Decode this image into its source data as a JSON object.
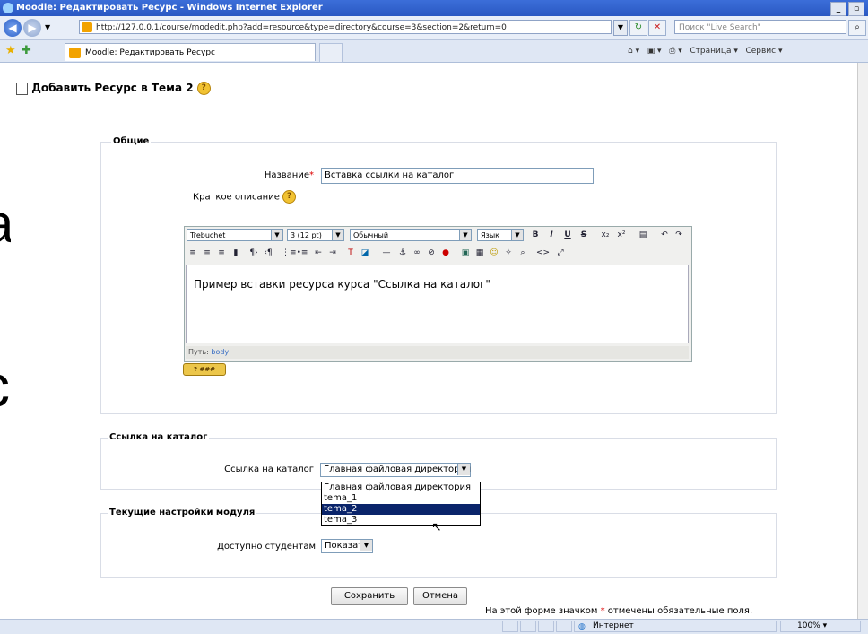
{
  "window": {
    "title": "Moodle: Редактировать Ресурс - Windows Internet Explorer",
    "url": "http://127.0.0.1/course/modedit.php?add=resource&type=directory&course=3&section=2&return=0",
    "search_placeholder": "Поиск \"Live Search\"",
    "tab_title": "Moodle: Редактировать Ресурс",
    "toolbar_page": "Страница",
    "toolbar_service": "Сервис"
  },
  "bleed": {
    "letter1": "a",
    "letter2": "c"
  },
  "page": {
    "heading": "Добавить Ресурс в Тема 2",
    "general_legend": "Общие",
    "name_label": "Название",
    "name_value": "Вставка ссылки на каталог",
    "summary_label": "Краткое описание",
    "editor": {
      "font": "Trebuchet",
      "size": "3 (12 pt)",
      "format": "Обычный",
      "lang": "Язык",
      "content": "Пример вставки ресурса курса \"Ссылка на каталог\"",
      "path_label": "Путь:",
      "path_value": "body",
      "help_btn": "? ###"
    },
    "link_legend": "Ссылка на каталог",
    "link_label": "Ссылка на каталог",
    "link_value": "Главная файловая директория",
    "dropdown_options": [
      "Главная файловая директория",
      "tema_1",
      "tema_2",
      "tema_3"
    ],
    "settings_legend": "Текущие настройки модуля",
    "visible_label": "Доступно студентам",
    "visible_value": "Показать",
    "save_button": "Сохранить",
    "cancel_button": "Отмена",
    "required_note_pre": "На этой форме значком",
    "required_note_star": "*",
    "required_note_post": "отмечены обязательные поля."
  },
  "status": {
    "zone": "Интернет",
    "zoom": "100%"
  }
}
